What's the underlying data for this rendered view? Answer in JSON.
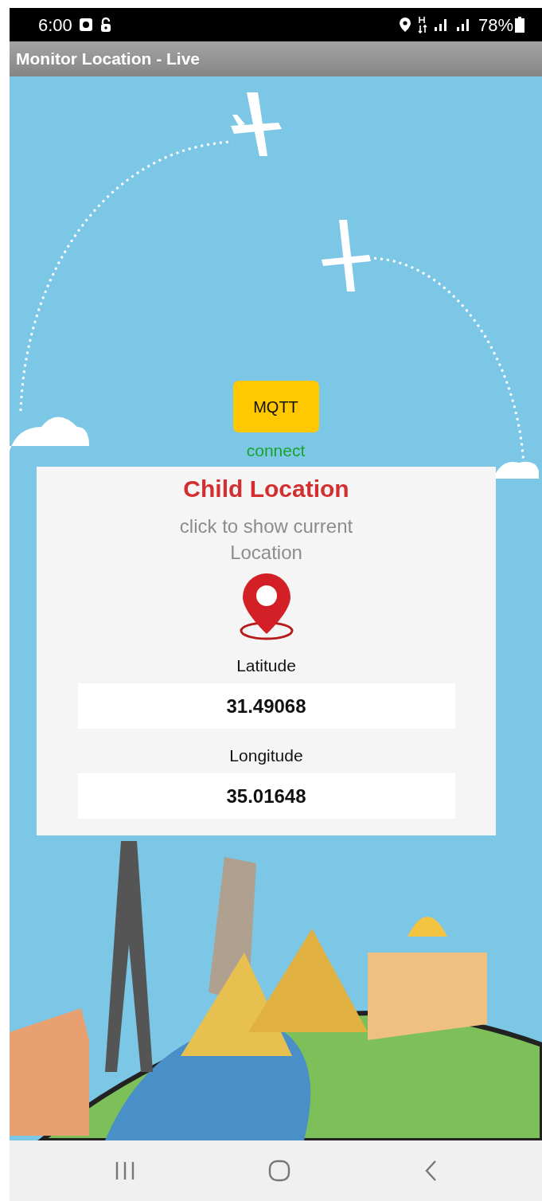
{
  "status_bar": {
    "time": "6:00",
    "battery": "78%"
  },
  "app_bar": {
    "title": "Monitor Location - Live"
  },
  "mqtt_button": {
    "label": "MQTT"
  },
  "connection_status": "connect",
  "location_card": {
    "title": "Child Location",
    "hint": "click to show current Location",
    "fields": [
      {
        "label": "Latitude",
        "value": "31.49068"
      },
      {
        "label": "Longitude",
        "value": "35.01648"
      }
    ]
  }
}
